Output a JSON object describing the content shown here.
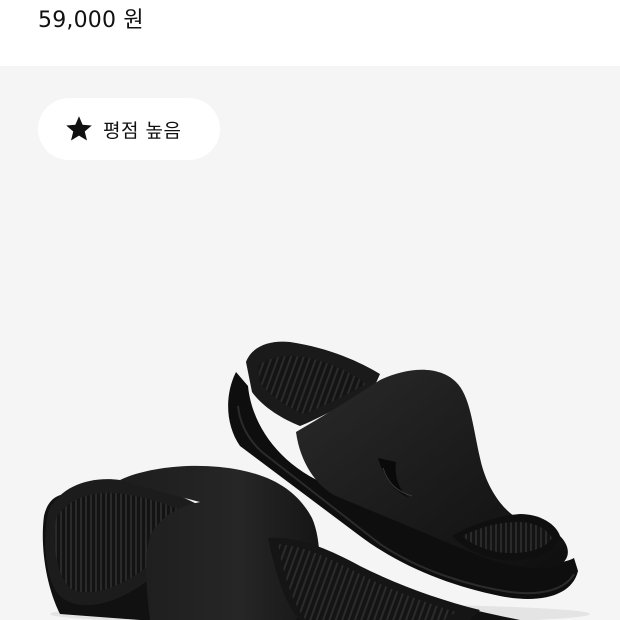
{
  "product": {
    "price": "59,000 원"
  },
  "badge": {
    "label": "평점 높음",
    "icon": "star-icon"
  },
  "image": {
    "subject": "slide-sandals-image"
  },
  "colors": {
    "page_background": "#ffffff",
    "image_background": "#f5f5f5",
    "badge_background": "#ffffff",
    "text": "#111111",
    "sandal": "#1a1a1a"
  }
}
